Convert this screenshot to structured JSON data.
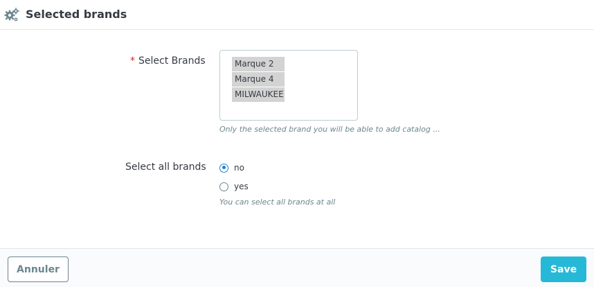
{
  "header": {
    "icon": "cogs-icon",
    "title": "Selected brands"
  },
  "form": {
    "select_brands": {
      "required_mark": "*",
      "label": "Select Brands",
      "options": [
        "Marque 2",
        "Marque 4",
        "MILWAUKEE"
      ],
      "help": "Only the selected brand you will be able to add catalog ..."
    },
    "select_all_brands": {
      "label": "Select all brands",
      "options": [
        {
          "label": "no",
          "checked": true
        },
        {
          "label": "yes",
          "checked": false
        }
      ],
      "help": "You can select all brands at all"
    }
  },
  "footer": {
    "cancel_label": "Annuler",
    "save_label": "Save"
  },
  "colors": {
    "primary": "#25b9d7",
    "radio_checked": "#1f7fd1",
    "required": "#c72b2b",
    "help_text": "#6c868e"
  }
}
